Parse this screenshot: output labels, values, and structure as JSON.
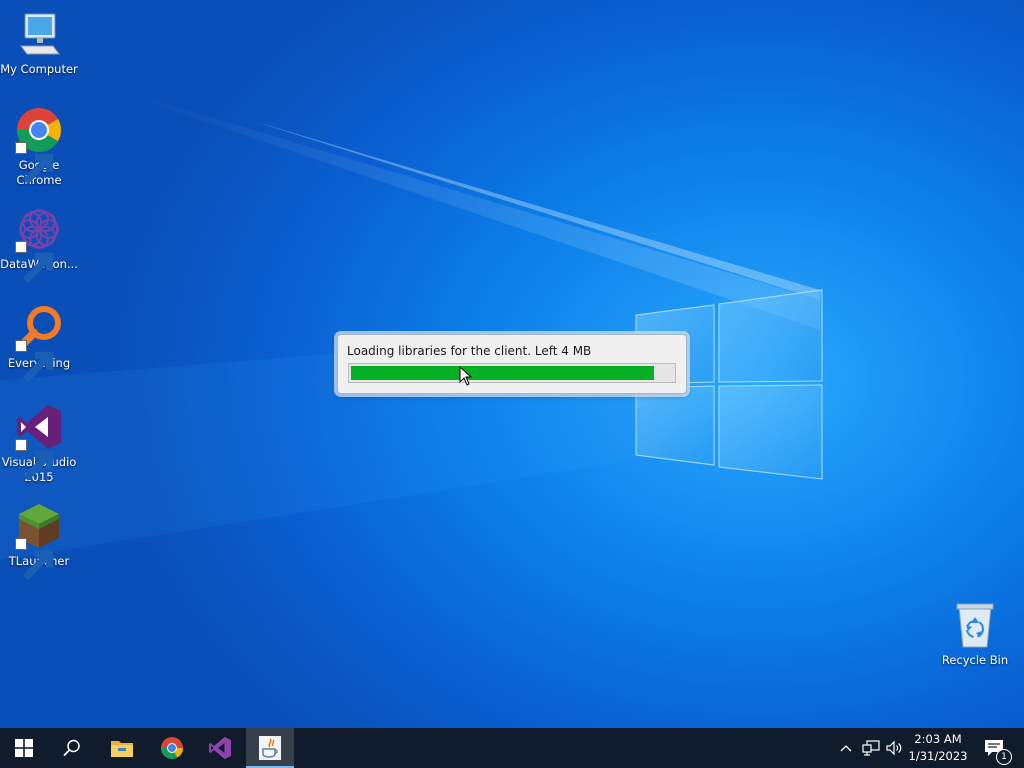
{
  "desktop": {
    "icons": [
      {
        "label": "My Computer"
      },
      {
        "label": "Google Chrome"
      },
      {
        "label": "DataWagon..."
      },
      {
        "label": "Everything"
      },
      {
        "label": "Visual Studio 2015"
      },
      {
        "label": "TLauncher"
      },
      {
        "label": "Recycle Bin"
      }
    ]
  },
  "dialog": {
    "message": "Loading libraries for the client. Left 4 MB",
    "progress_fraction": 0.94,
    "progress_color": "#06b025"
  },
  "taskbar": {
    "buttons": [
      {
        "icon": "windows-start-icon"
      },
      {
        "icon": "search-icon"
      },
      {
        "icon": "file-explorer-icon"
      },
      {
        "icon": "chrome-icon"
      },
      {
        "icon": "visual-studio-icon"
      },
      {
        "icon": "java-icon",
        "active": true
      }
    ],
    "tray": {
      "time": "2:03 AM",
      "date": "1/31/2023",
      "notification_count": "1"
    }
  },
  "colors": {
    "taskbar": "#101c2b",
    "wallpaper": "#0a6fe0",
    "accent": "#76b9ed"
  }
}
